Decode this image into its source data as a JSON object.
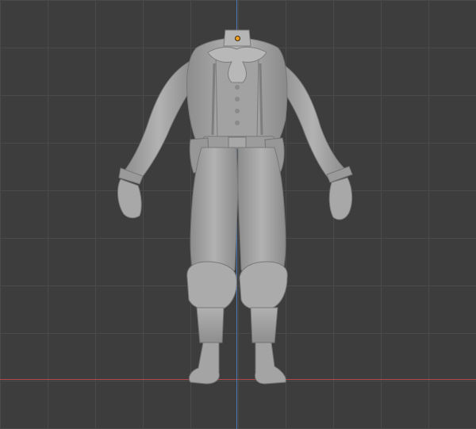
{
  "viewport": {
    "background_color": "#3d3d3d",
    "grid_color": "#4a4a4a",
    "x_axis_color": "#b04a4a",
    "y_axis_color": "#4f78b0",
    "origin_color": "#f2a020",
    "model_color": "#a6a6a6"
  },
  "model": {
    "icon": "character-mesh-icon"
  }
}
